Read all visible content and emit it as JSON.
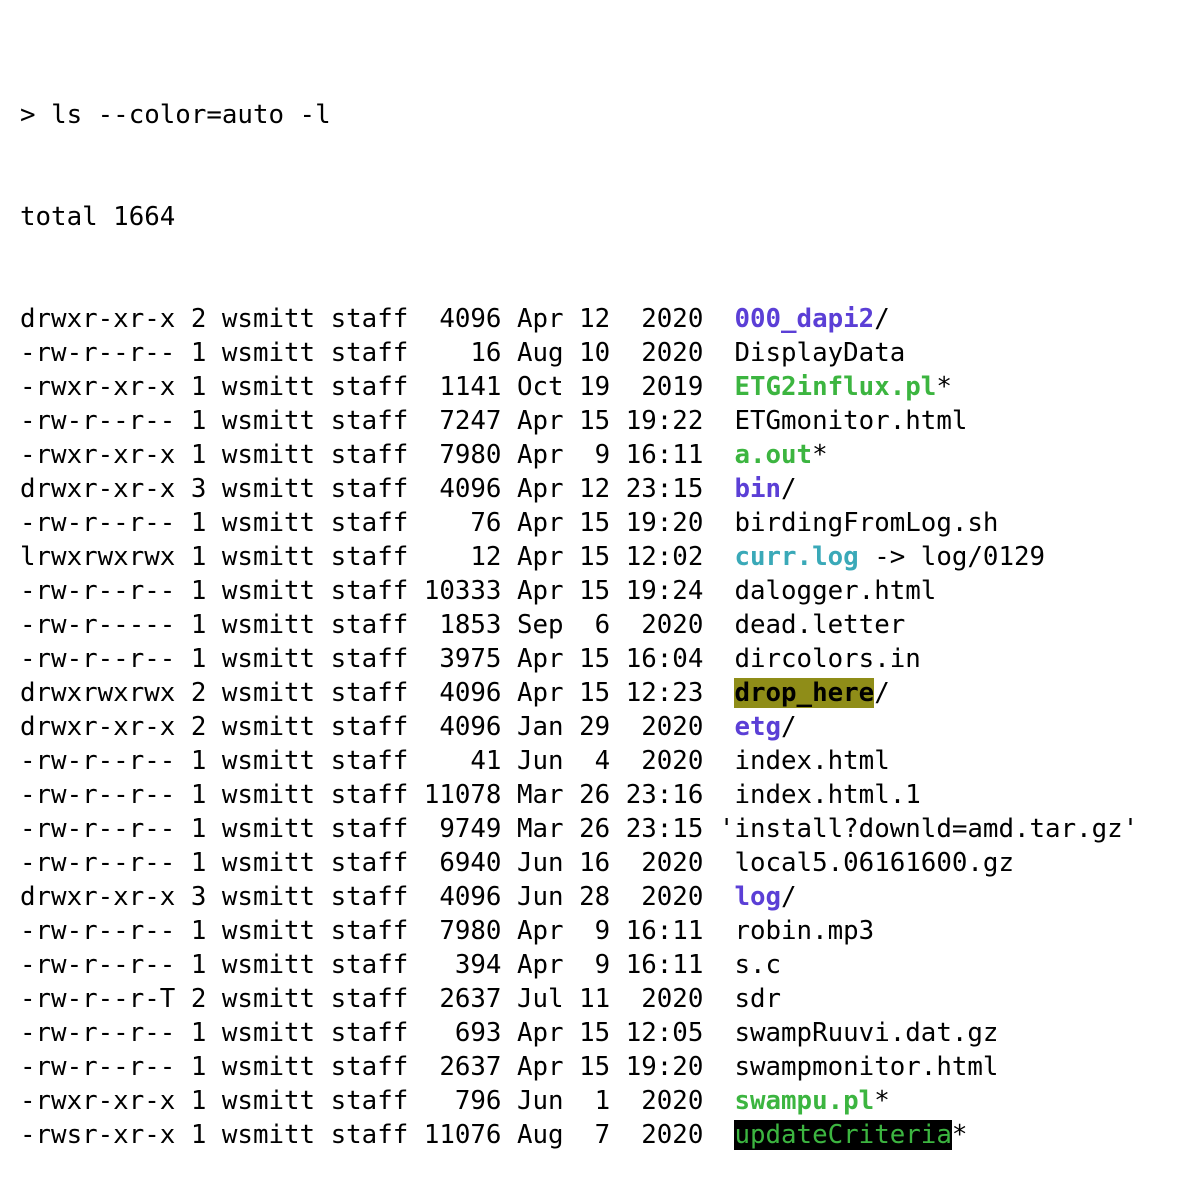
{
  "terminal": {
    "prompt": "> ",
    "command": "ls --color=auto -l",
    "total_line": "total 1664",
    "colors": {
      "directory": "#5b3fd6",
      "executable": "#3cb540",
      "symlink": "#3aa9b8",
      "other_writable_bg": "#8f8d18",
      "setuid_bg": "#000000"
    },
    "entries": [
      {
        "perms": "drwxr-xr-x",
        "links": "2",
        "owner": "wsmitt",
        "group": "staff",
        "size": " 4096",
        "month": "Apr",
        "day": "12",
        "time": " 2020",
        "name": "000_dapi2",
        "suffix": "/",
        "kind": "dir"
      },
      {
        "perms": "-rw-r--r--",
        "links": "1",
        "owner": "wsmitt",
        "group": "staff",
        "size": "   16",
        "month": "Aug",
        "day": "10",
        "time": " 2020",
        "name": "DisplayData",
        "suffix": "",
        "kind": "plain"
      },
      {
        "perms": "-rwxr-xr-x",
        "links": "1",
        "owner": "wsmitt",
        "group": "staff",
        "size": " 1141",
        "month": "Oct",
        "day": "19",
        "time": " 2019",
        "name": "ETG2influx.pl",
        "suffix": "*",
        "kind": "exec"
      },
      {
        "perms": "-rw-r--r--",
        "links": "1",
        "owner": "wsmitt",
        "group": "staff",
        "size": " 7247",
        "month": "Apr",
        "day": "15",
        "time": "19:22",
        "name": "ETGmonitor.html",
        "suffix": "",
        "kind": "plain"
      },
      {
        "perms": "-rwxr-xr-x",
        "links": "1",
        "owner": "wsmitt",
        "group": "staff",
        "size": " 7980",
        "month": "Apr",
        "day": " 9",
        "time": "16:11",
        "name": "a.out",
        "suffix": "*",
        "kind": "exec"
      },
      {
        "perms": "drwxr-xr-x",
        "links": "3",
        "owner": "wsmitt",
        "group": "staff",
        "size": " 4096",
        "month": "Apr",
        "day": "12",
        "time": "23:15",
        "name": "bin",
        "suffix": "/",
        "kind": "dir"
      },
      {
        "perms": "-rw-r--r--",
        "links": "1",
        "owner": "wsmitt",
        "group": "staff",
        "size": "   76",
        "month": "Apr",
        "day": "15",
        "time": "19:20",
        "name": "birdingFromLog.sh",
        "suffix": "",
        "kind": "plain"
      },
      {
        "perms": "lrwxrwxrwx",
        "links": "1",
        "owner": "wsmitt",
        "group": "staff",
        "size": "   12",
        "month": "Apr",
        "day": "15",
        "time": "12:02",
        "name": "curr.log",
        "suffix": " -> log/0129",
        "kind": "link"
      },
      {
        "perms": "-rw-r--r--",
        "links": "1",
        "owner": "wsmitt",
        "group": "staff",
        "size": "10333",
        "month": "Apr",
        "day": "15",
        "time": "19:24",
        "name": "dalogger.html",
        "suffix": "",
        "kind": "plain"
      },
      {
        "perms": "-rw-r-----",
        "links": "1",
        "owner": "wsmitt",
        "group": "staff",
        "size": " 1853",
        "month": "Sep",
        "day": " 6",
        "time": " 2020",
        "name": "dead.letter",
        "suffix": "",
        "kind": "plain"
      },
      {
        "perms": "-rw-r--r--",
        "links": "1",
        "owner": "wsmitt",
        "group": "staff",
        "size": " 3975",
        "month": "Apr",
        "day": "15",
        "time": "16:04",
        "name": "dircolors.in",
        "suffix": "",
        "kind": "plain"
      },
      {
        "perms": "drwxrwxrwx",
        "links": "2",
        "owner": "wsmitt",
        "group": "staff",
        "size": " 4096",
        "month": "Apr",
        "day": "15",
        "time": "12:23",
        "name": "drop_here",
        "suffix": "/",
        "kind": "otherwritable"
      },
      {
        "perms": "drwxr-xr-x",
        "links": "2",
        "owner": "wsmitt",
        "group": "staff",
        "size": " 4096",
        "month": "Jan",
        "day": "29",
        "time": " 2020",
        "name": "etg",
        "suffix": "/",
        "kind": "dir"
      },
      {
        "perms": "-rw-r--r--",
        "links": "1",
        "owner": "wsmitt",
        "group": "staff",
        "size": "   41",
        "month": "Jun",
        "day": " 4",
        "time": " 2020",
        "name": "index.html",
        "suffix": "",
        "kind": "plain"
      },
      {
        "perms": "-rw-r--r--",
        "links": "1",
        "owner": "wsmitt",
        "group": "staff",
        "size": "11078",
        "month": "Mar",
        "day": "26",
        "time": "23:16",
        "name": "index.html.1",
        "suffix": "",
        "kind": "plain"
      },
      {
        "perms": "-rw-r--r--",
        "links": "1",
        "owner": "wsmitt",
        "group": "staff",
        "size": " 9749",
        "month": "Mar",
        "day": "26",
        "time": "23:15",
        "name": "'install?downld=amd.tar.gz'",
        "suffix": "",
        "kind": "quoted"
      },
      {
        "perms": "-rw-r--r--",
        "links": "1",
        "owner": "wsmitt",
        "group": "staff",
        "size": " 6940",
        "month": "Jun",
        "day": "16",
        "time": " 2020",
        "name": "local5.06161600.gz",
        "suffix": "",
        "kind": "plain"
      },
      {
        "perms": "drwxr-xr-x",
        "links": "3",
        "owner": "wsmitt",
        "group": "staff",
        "size": " 4096",
        "month": "Jun",
        "day": "28",
        "time": " 2020",
        "name": "log",
        "suffix": "/",
        "kind": "dir"
      },
      {
        "perms": "-rw-r--r--",
        "links": "1",
        "owner": "wsmitt",
        "group": "staff",
        "size": " 7980",
        "month": "Apr",
        "day": " 9",
        "time": "16:11",
        "name": "robin.mp3",
        "suffix": "",
        "kind": "plain"
      },
      {
        "perms": "-rw-r--r--",
        "links": "1",
        "owner": "wsmitt",
        "group": "staff",
        "size": "  394",
        "month": "Apr",
        "day": " 9",
        "time": "16:11",
        "name": "s.c",
        "suffix": "",
        "kind": "plain"
      },
      {
        "perms": "-rw-r--r-T",
        "links": "2",
        "owner": "wsmitt",
        "group": "staff",
        "size": " 2637",
        "month": "Jul",
        "day": "11",
        "time": " 2020",
        "name": "sdr",
        "suffix": "",
        "kind": "plain"
      },
      {
        "perms": "-rw-r--r--",
        "links": "1",
        "owner": "wsmitt",
        "group": "staff",
        "size": "  693",
        "month": "Apr",
        "day": "15",
        "time": "12:05",
        "name": "swampRuuvi.dat.gz",
        "suffix": "",
        "kind": "plain"
      },
      {
        "perms": "-rw-r--r--",
        "links": "1",
        "owner": "wsmitt",
        "group": "staff",
        "size": " 2637",
        "month": "Apr",
        "day": "15",
        "time": "19:20",
        "name": "swampmonitor.html",
        "suffix": "",
        "kind": "plain"
      },
      {
        "perms": "-rwxr-xr-x",
        "links": "1",
        "owner": "wsmitt",
        "group": "staff",
        "size": "  796",
        "month": "Jun",
        "day": " 1",
        "time": " 2020",
        "name": "swampu.pl",
        "suffix": "*",
        "kind": "exec"
      },
      {
        "perms": "-rwsr-xr-x",
        "links": "1",
        "owner": "wsmitt",
        "group": "staff",
        "size": "11076",
        "month": "Aug",
        "day": " 7",
        "time": " 2020",
        "name": "updateCriteria",
        "suffix": "*",
        "kind": "setuid"
      }
    ]
  }
}
